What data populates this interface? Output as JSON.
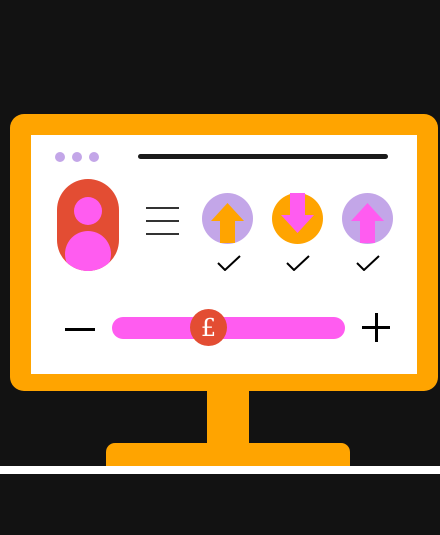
{
  "colors": {
    "background": "#121212",
    "frame": "#FFA400",
    "screen": "#FFFFFF",
    "lavender": "#C3A6E8",
    "pink": "#FF5CF0",
    "red": "#E34D33",
    "dark": "#1A1A1A"
  },
  "icons": {
    "arrow_items": [
      {
        "name": "arrow-up-icon",
        "circle_color": "#C3A6E8",
        "arrow_color": "#FFA400",
        "direction": "up"
      },
      {
        "name": "arrow-down-icon",
        "circle_color": "#FFA400",
        "arrow_color": "#FF5CF0",
        "direction": "down"
      },
      {
        "name": "arrow-up-icon",
        "circle_color": "#C3A6E8",
        "arrow_color": "#FF5CF0",
        "direction": "up"
      }
    ],
    "check": "check-icon",
    "avatar": "user-avatar-icon",
    "menu": "hamburger-menu-icon"
  },
  "slider": {
    "minus_label": "−",
    "plus_label": "+",
    "currency_symbol": "£",
    "value_fraction": 0.38
  }
}
